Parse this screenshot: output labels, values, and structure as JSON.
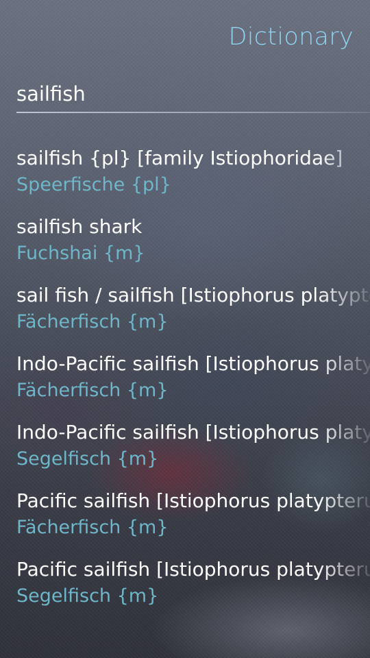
{
  "header": {
    "title": "Dictionary"
  },
  "search": {
    "value": "sailfish"
  },
  "results": [
    {
      "term": "sailfish {pl} [family Istiophoridae]",
      "translation": "Speerfische {pl}"
    },
    {
      "term": "sailfish shark",
      "translation": "Fuchshai {m}"
    },
    {
      "term": "sail fish / sailfish [Istiophorus platypterus]",
      "translation": "Fächerfisch {m}"
    },
    {
      "term": "Indo-Pacific sailfish [Istiophorus platypterus]",
      "translation": "Fächerfisch {m}"
    },
    {
      "term": "Indo-Pacific sailfish [Istiophorus platypterus]",
      "translation": "Segelfisch {m}"
    },
    {
      "term": "Pacific sailfish [Istiophorus platypterus]",
      "translation": "Fächerfisch {m}"
    },
    {
      "term": "Pacific sailfish [Istiophorus platypterus]",
      "translation": "Segelfisch {m}"
    }
  ],
  "colors": {
    "accent": "#8fd3ee",
    "translation": "#6fb6c8",
    "text": "#ffffff"
  }
}
